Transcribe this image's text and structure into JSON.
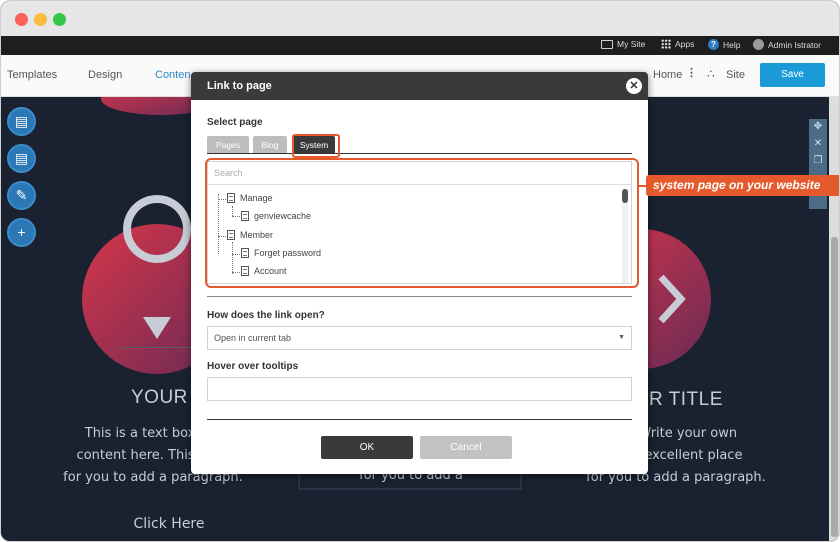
{
  "admin_bar": {
    "my_site": "My Site",
    "apps": "Apps",
    "help": "Help",
    "user": "Admin Istrator"
  },
  "toolbar": {
    "templates": "Templates",
    "design": "Design",
    "content": "Conten",
    "home": "Home",
    "site": "Site",
    "save": "Save"
  },
  "page": {
    "card1_title": "YOUR TIT",
    "card1_text": [
      "This is a text box. Wr",
      "content here. This is an",
      "for you to add a paragraph."
    ],
    "card1_link": "Click Here",
    "card2_text": "for you to add a",
    "card3_title": "R TITLE",
    "card3_text": [
      "ox. Write your own",
      "is an excellent place",
      "for you to add a paragraph."
    ]
  },
  "dialog": {
    "title": "Link to page",
    "close_icon": "close-icon",
    "select_page_label": "Select page",
    "tabs": [
      {
        "label": "Pages",
        "active": false
      },
      {
        "label": "Blog",
        "active": false
      },
      {
        "label": "System",
        "active": true
      }
    ],
    "search_placeholder": "Search",
    "tree": {
      "manage": "Manage",
      "genviewcache": "genviewcache",
      "member": "Member",
      "forgot_password": "Forget password",
      "account": "Account"
    },
    "link_open_label": "How does the link open?",
    "link_open_value": "Open in current tab",
    "tooltips_label": "Hover over tooltips",
    "tooltips_value": "",
    "ok": "OK",
    "cancel": "Cancel"
  },
  "annotation": {
    "callout": "system page on your website",
    "color": "#e45a2d"
  }
}
